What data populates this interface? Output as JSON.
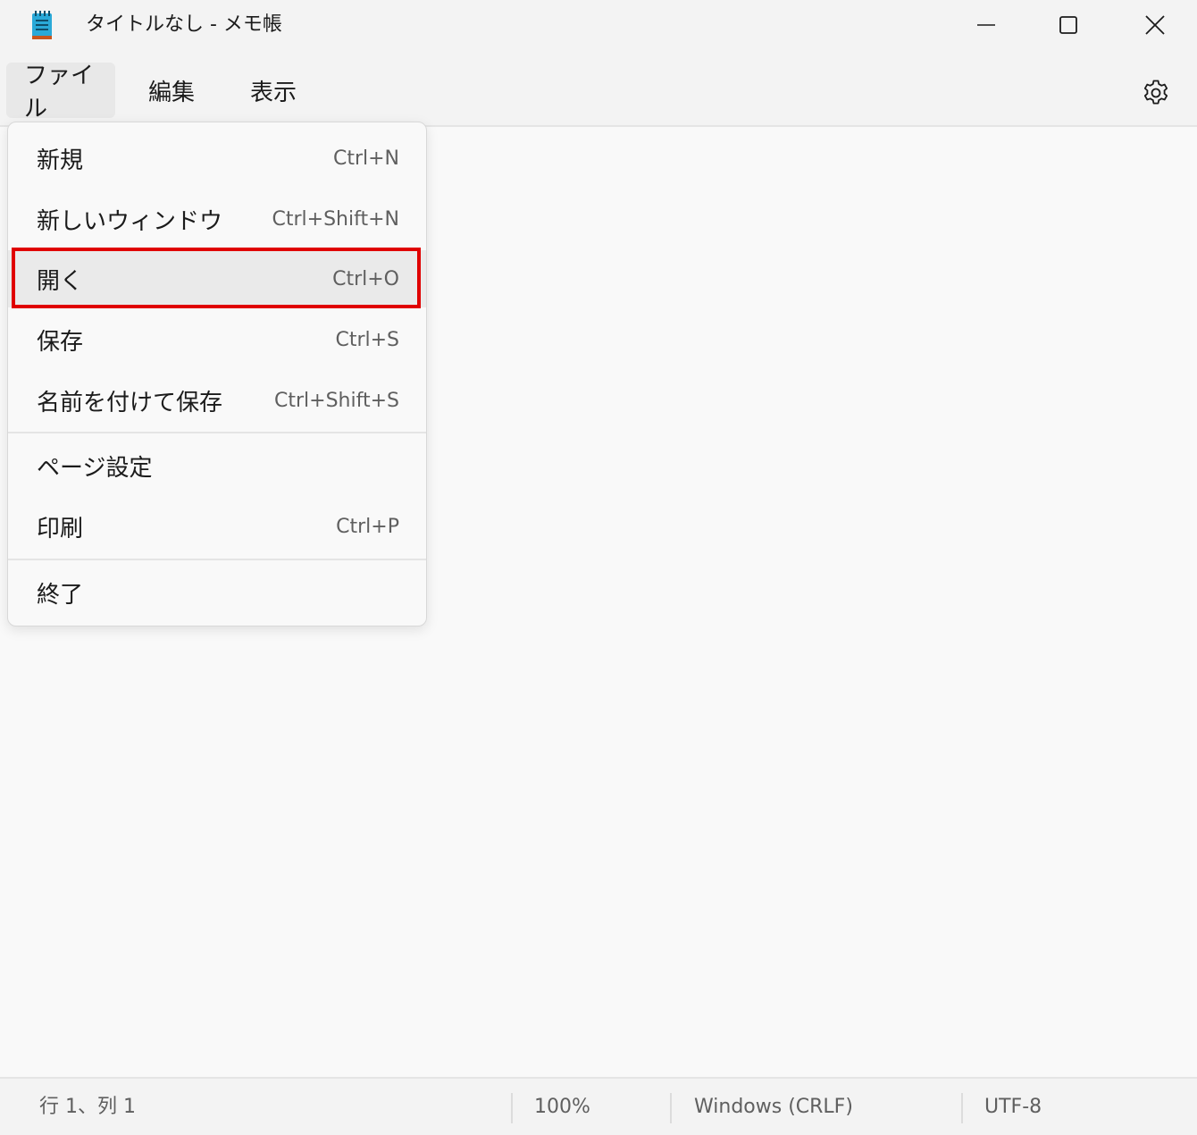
{
  "window": {
    "title": "タイトルなし - メモ帳"
  },
  "menubar": {
    "file": "ファイル",
    "edit": "編集",
    "view": "表示"
  },
  "file_menu": {
    "items": [
      {
        "label": "新規",
        "shortcut": "Ctrl+N"
      },
      {
        "label": "新しいウィンドウ",
        "shortcut": "Ctrl+Shift+N"
      },
      {
        "label": "開く",
        "shortcut": "Ctrl+O"
      },
      {
        "label": "保存",
        "shortcut": "Ctrl+S"
      },
      {
        "label": "名前を付けて保存",
        "shortcut": "Ctrl+Shift+S"
      },
      {
        "label": "ページ設定",
        "shortcut": ""
      },
      {
        "label": "印刷",
        "shortcut": "Ctrl+P"
      },
      {
        "label": "終了",
        "shortcut": ""
      }
    ],
    "highlighted_item": "開く"
  },
  "statusbar": {
    "position": "行 1、列 1",
    "zoom": "100%",
    "line_ending": "Windows (CRLF)",
    "encoding": "UTF-8"
  },
  "colors": {
    "highlight_border": "#e00000",
    "app_icon": "#2aa9d8"
  },
  "icons": {
    "app": "notepad-icon",
    "minimize": "minimize-icon",
    "maximize": "maximize-icon",
    "close": "close-icon",
    "settings": "gear-icon"
  }
}
